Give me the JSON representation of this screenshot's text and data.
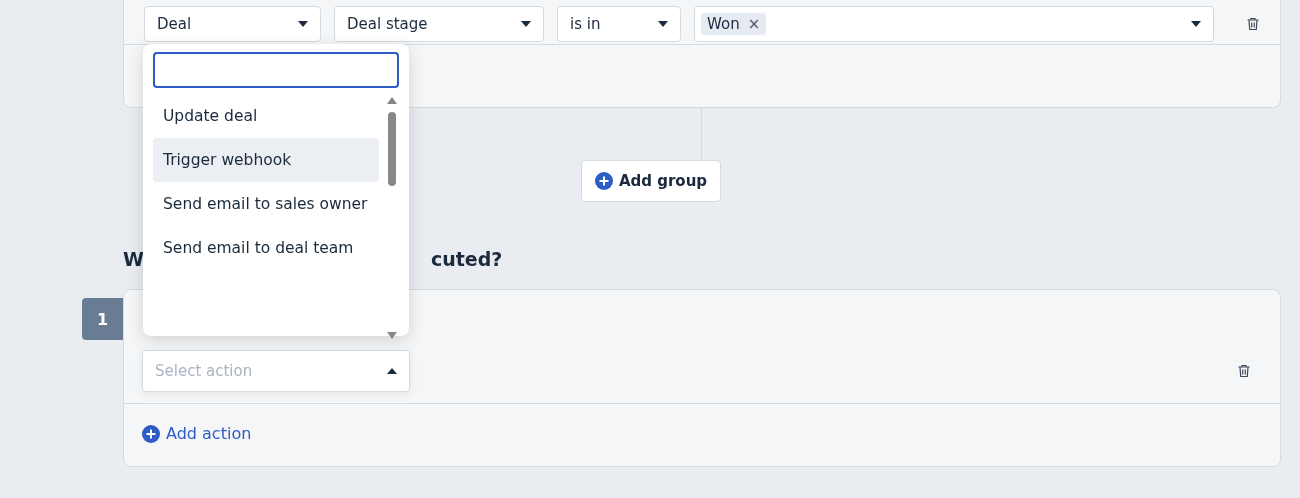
{
  "condition_row": {
    "fields": [
      {
        "kind": "select",
        "value": "Deal"
      },
      {
        "kind": "select",
        "value": "Deal stage"
      },
      {
        "kind": "select",
        "value": "is in"
      },
      {
        "kind": "multiselect",
        "chips": [
          "Won"
        ],
        "chip_remove": "×"
      }
    ]
  },
  "add_group_button": {
    "label": "Add group"
  },
  "heading_parts": [
    "W",
    "cuted?"
  ],
  "action_steps": [
    {
      "number": "1",
      "select": {
        "placeholder": "Select action",
        "expanded": true
      }
    }
  ],
  "add_action": {
    "label": "Add action"
  },
  "dropdown": {
    "options": [
      {
        "label": "Update deal",
        "selected": false
      },
      {
        "label": "Trigger webhook",
        "selected": true
      },
      {
        "label": "Send email to sales owner",
        "selected": false
      },
      {
        "label": "Send email to deal team",
        "selected": false
      }
    ]
  }
}
